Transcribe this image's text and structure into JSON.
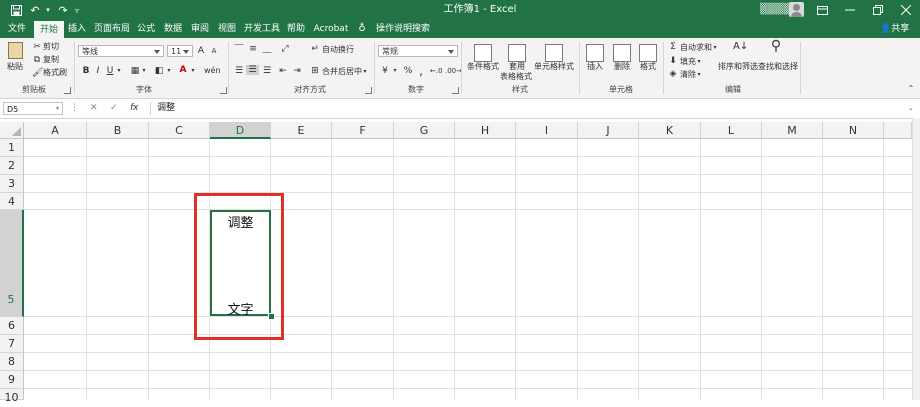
{
  "window": {
    "title": "工作簿1 - Excel",
    "user": "▒▒▒▒▒"
  },
  "tabs": [
    {
      "label": "文件"
    },
    {
      "label": "开始"
    },
    {
      "label": "插入"
    },
    {
      "label": "页面布局"
    },
    {
      "label": "公式"
    },
    {
      "label": "数据"
    },
    {
      "label": "审阅"
    },
    {
      "label": "视图"
    },
    {
      "label": "开发工具"
    },
    {
      "label": "帮助"
    },
    {
      "label": "Acrobat"
    },
    {
      "label": "操作说明搜索"
    }
  ],
  "share_label": "共享",
  "ribbon": {
    "clipboard": {
      "paste": "粘贴",
      "cut": "剪切",
      "copy": "复制",
      "format_painter": "格式刷",
      "label": "剪贴板"
    },
    "font": {
      "name": "等线",
      "size": "11",
      "label": "字体"
    },
    "alignment": {
      "wrap": "自动换行",
      "merge": "合并后居中",
      "label": "对齐方式"
    },
    "number": {
      "format": "常规",
      "label": "数字"
    },
    "styles": {
      "conditional": "条件格式",
      "table_line1": "套用",
      "table_line2": "表格格式",
      "cell_styles": "单元格样式",
      "label": "样式"
    },
    "cells": {
      "insert": "插入",
      "delete": "删除",
      "format": "格式",
      "label": "单元格"
    },
    "editing": {
      "autosum": "自动求和",
      "fill": "填充",
      "clear": "清除",
      "sort_filter": "排序和筛选",
      "find_select": "查找和选择",
      "label": "编辑"
    }
  },
  "formula_bar": {
    "name_box": "D5",
    "content": "调整"
  },
  "columns": [
    "A",
    "B",
    "C",
    "D",
    "E",
    "F",
    "G",
    "H",
    "I",
    "J",
    "K",
    "L",
    "M",
    "N"
  ],
  "rows": [
    "1",
    "2",
    "3",
    "4",
    "5",
    "6",
    "7",
    "8",
    "9",
    "10"
  ],
  "cell_d5": {
    "line1": "调整",
    "line2": "文字"
  },
  "colors": {
    "accent": "#217346",
    "highlight": "#e0302a"
  }
}
